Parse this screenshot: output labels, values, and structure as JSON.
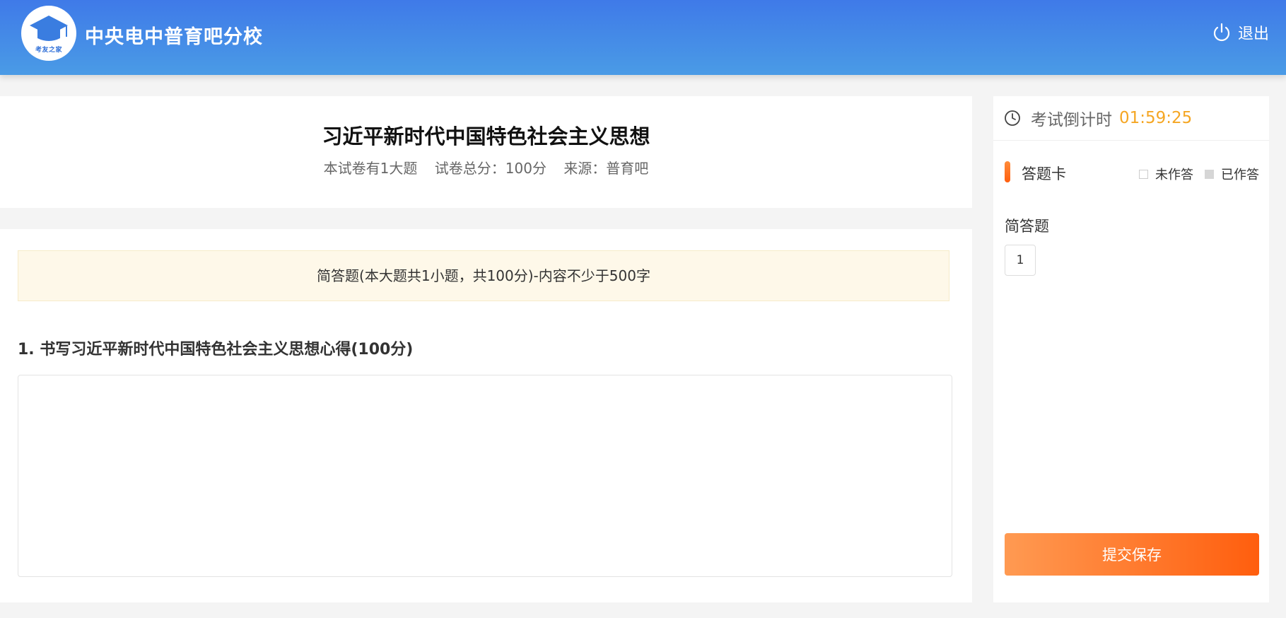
{
  "header": {
    "logo_text": "考友之家",
    "site_name": "中央电中普育吧分校",
    "logout_label": "退出"
  },
  "paper": {
    "title": "习近平新时代中国特色社会主义思想",
    "meta_count": "本试卷有1大题",
    "meta_score": "试卷总分：100分",
    "meta_source": "来源：普育吧"
  },
  "section": {
    "banner": "简答题(本大题共1小题，共100分)-内容不少于500字"
  },
  "question": {
    "title": "1. 书写习近平新时代中国特色社会主义思想心得(100分)",
    "answer_value": ""
  },
  "sidebar": {
    "timer_label": "考试倒计时",
    "timer_value": "01:59:25",
    "card_title": "答题卡",
    "legend_unanswered": "未作答",
    "legend_answered": "已作答",
    "qtype_label": "简答题",
    "question_numbers": [
      "1"
    ],
    "submit_label": "提交保存"
  },
  "colors": {
    "header_gradient_start": "#3f7ae8",
    "header_gradient_end": "#4a9be6",
    "timer": "#f5a623",
    "accent_orange": "#ff5e0e"
  },
  "icons": {
    "logo": "graduation-cap-icon",
    "logout": "power-icon",
    "timer": "clock-icon"
  }
}
